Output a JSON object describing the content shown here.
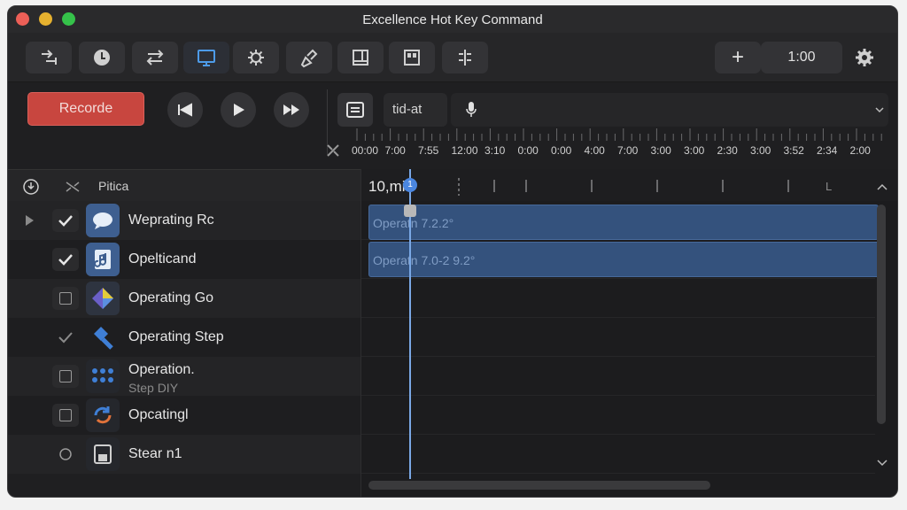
{
  "window": {
    "title": "Excellence Hot Key Command"
  },
  "toolbar": {
    "buttons": [
      {
        "name": "import-icon"
      },
      {
        "name": "clock-icon"
      },
      {
        "name": "swap-icon"
      },
      {
        "name": "monitor-icon"
      },
      {
        "name": "gear-bug-icon"
      },
      {
        "name": "pen-icon"
      },
      {
        "name": "window-icon"
      },
      {
        "name": "grid-icon"
      },
      {
        "name": "align-icon"
      }
    ],
    "add_label": "+",
    "time_value": "1:00"
  },
  "transport": {
    "record_label": "Recorde",
    "search_value": "tid-at"
  },
  "ruler": {
    "labels": [
      "00:00",
      "7:00",
      "7:55",
      "12:00",
      "3:10",
      "0:00",
      "0:00",
      "4:00",
      "7:00",
      "3:00",
      "3:00",
      "2:30",
      "3:00",
      "3:52",
      "2:34",
      "2:00"
    ]
  },
  "list": {
    "header_label": "Pitica",
    "rows": [
      {
        "label": "Weprating Rc",
        "sub": "",
        "checked": true,
        "thumb": "chat-bubble-icon",
        "expander": true
      },
      {
        "label": "Opelticand",
        "sub": "",
        "checked": true,
        "thumb": "music-file-icon",
        "expander": false
      },
      {
        "label": "Operating Go",
        "sub": "",
        "checked": false,
        "thumb": "diamond-shape-icon",
        "expander": false
      },
      {
        "label": "Operating Step",
        "sub": "",
        "checked": true,
        "thumb": "hammer-icon",
        "expander": false
      },
      {
        "label": "Operation.",
        "sub": "Step DIY",
        "checked": false,
        "thumb": "dots-grid-icon",
        "expander": false
      },
      {
        "label": "Opcatingl",
        "sub": "",
        "checked": false,
        "thumb": "refresh-icon",
        "expander": false
      },
      {
        "label": "Stear n1",
        "sub": "",
        "checked": false,
        "thumb": "save-disk-icon",
        "expander": false
      }
    ]
  },
  "timeline": {
    "time_label": "10,mi",
    "playhead_label": "1",
    "end_marker": "L",
    "clips": [
      {
        "label": "Operatn 7.2.2°"
      },
      {
        "label": "Operatn 7.0-2 9.2°"
      }
    ]
  },
  "colors": {
    "accent": "#4a86e0",
    "record": "#c8463f",
    "clip": "#34527d"
  }
}
